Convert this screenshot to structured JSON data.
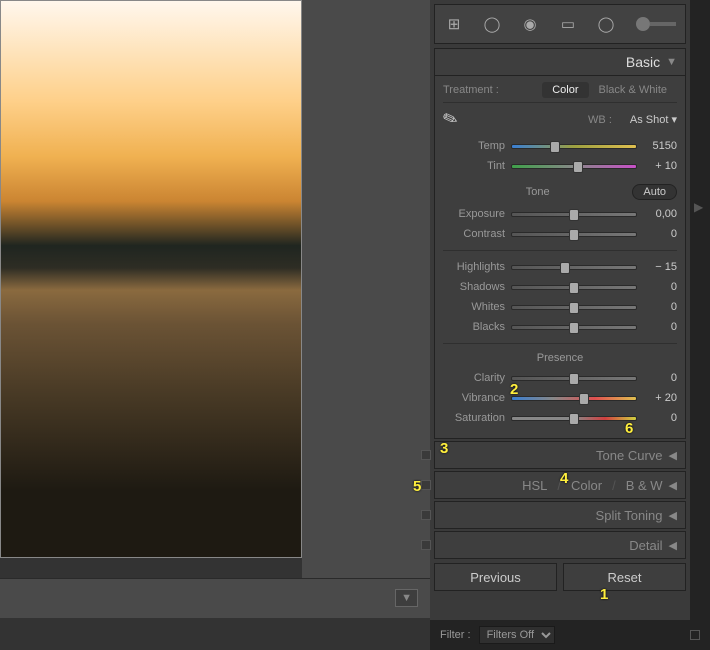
{
  "panels": {
    "basic": "Basic",
    "tone_curve": "Tone Curve",
    "hsl": {
      "a": "HSL",
      "b": "Color",
      "c": "B & W"
    },
    "split_toning": "Split Toning",
    "detail": "Detail"
  },
  "treatment": {
    "label": "Treatment :",
    "color": "Color",
    "bw": "Black & White"
  },
  "wb": {
    "label": "WB :",
    "mode": "As Shot ▾"
  },
  "sliders": {
    "temp": {
      "label": "Temp",
      "value": "5150",
      "pos": 35
    },
    "tint": {
      "label": "Tint",
      "value": "+ 10",
      "pos": 53
    },
    "exposure": {
      "label": "Exposure",
      "value": "0,00",
      "pos": 50
    },
    "contrast": {
      "label": "Contrast",
      "value": "0",
      "pos": 50
    },
    "highlights": {
      "label": "Highlights",
      "value": "− 15",
      "pos": 43
    },
    "shadows": {
      "label": "Shadows",
      "value": "0",
      "pos": 50
    },
    "whites": {
      "label": "Whites",
      "value": "0",
      "pos": 50
    },
    "blacks": {
      "label": "Blacks",
      "value": "0",
      "pos": 50
    },
    "clarity": {
      "label": "Clarity",
      "value": "0",
      "pos": 50
    },
    "vibrance": {
      "label": "Vibrance",
      "value": "+ 20",
      "pos": 58
    },
    "saturation": {
      "label": "Saturation",
      "value": "0",
      "pos": 50
    }
  },
  "tone": {
    "label": "Tone",
    "auto": "Auto"
  },
  "presence": {
    "label": "Presence"
  },
  "buttons": {
    "previous": "Previous",
    "reset": "Reset"
  },
  "filter": {
    "label": "Filter :",
    "value": "Filters Off"
  },
  "annotations": {
    "a1": "1",
    "a2": "2",
    "a3": "3",
    "a4": "4",
    "a5": "5",
    "a6": "6"
  }
}
